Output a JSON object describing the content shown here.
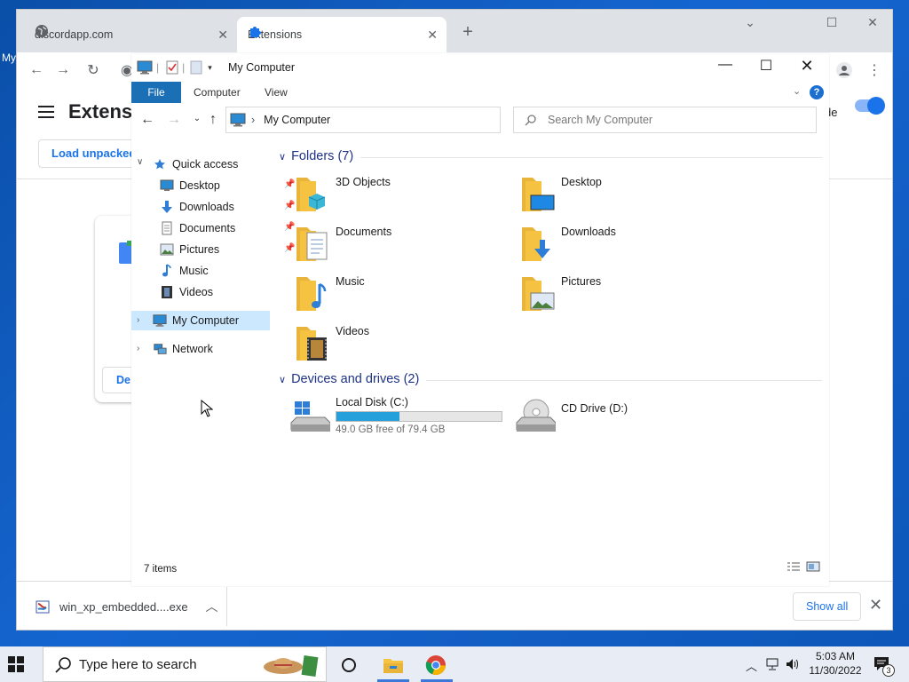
{
  "desktop": {
    "label": "My"
  },
  "browser": {
    "tabs": [
      {
        "label": "discordapp.com",
        "icon": "globe-icon"
      },
      {
        "label": "Extensions",
        "icon": "puzzle-icon"
      }
    ],
    "extensions_title": "Extensi",
    "dev_mode_label": "de",
    "load_unpacked": "Load unpacked",
    "card_button": "De",
    "download": {
      "filename": "win_xp_embedded....exe",
      "show_all": "Show all"
    }
  },
  "explorer": {
    "title": "My Computer",
    "ribbon_tabs": [
      "File",
      "Computer",
      "View"
    ],
    "address": "My Computer",
    "search_placeholder": "Search My Computer",
    "nav": {
      "quick_access": "Quick access",
      "quick_items": [
        "Desktop",
        "Downloads",
        "Documents",
        "Pictures",
        "Music",
        "Videos"
      ],
      "my_computer": "My Computer",
      "network": "Network"
    },
    "folders_header": "Folders (7)",
    "folders": [
      "3D Objects",
      "Desktop",
      "Documents",
      "Downloads",
      "Music",
      "Pictures",
      "Videos"
    ],
    "devices_header": "Devices and drives (2)",
    "drives": [
      {
        "name": "Local Disk (C:)",
        "free": "49.0 GB free of 79.4 GB",
        "used_fraction": 0.383
      },
      {
        "name": "CD Drive (D:)"
      }
    ],
    "status": "7 items"
  },
  "taskbar": {
    "search_placeholder": "Type here to search",
    "time": "5:03 AM",
    "date": "11/30/2022",
    "notifications": "3"
  },
  "colors": {
    "accent": "#1a73e8",
    "file_tab": "#1a6fb5",
    "drive_bar": "#26a0da",
    "folder": "#f5c242"
  }
}
